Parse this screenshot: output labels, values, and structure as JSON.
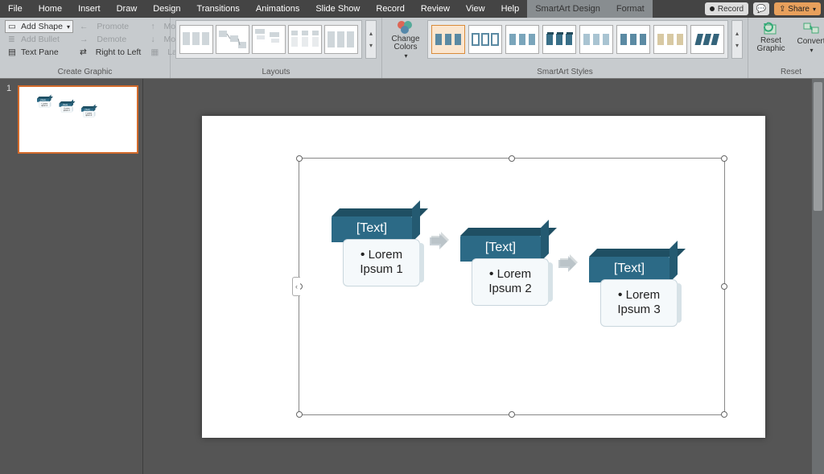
{
  "menu": {
    "tabs": [
      "File",
      "Home",
      "Insert",
      "Draw",
      "Design",
      "Transitions",
      "Animations",
      "Slide Show",
      "Record",
      "Review",
      "View",
      "Help",
      "SmartArt Design",
      "Format"
    ],
    "active": "SmartArt Design",
    "record": "Record",
    "share": "Share"
  },
  "ribbon": {
    "create": {
      "label": "Create Graphic",
      "add_shape": "Add Shape",
      "add_bullet": "Add Bullet",
      "text_pane": "Text Pane",
      "promote": "Promote",
      "demote": "Demote",
      "rtl": "Right to Left",
      "move_up": "Move Up",
      "move_down": "Move Down",
      "layout": "Layout"
    },
    "layouts": {
      "label": "Layouts"
    },
    "styles": {
      "label": "SmartArt Styles",
      "change_colors": "Change Colors"
    },
    "reset": {
      "label": "Reset",
      "reset_graphic": "Reset Graphic",
      "convert": "Convert"
    }
  },
  "thumbs": {
    "num": "1"
  },
  "smartart": {
    "blocks": [
      {
        "title": "[Text]",
        "body": "Lorem Ipsum 1"
      },
      {
        "title": "[Text]",
        "body": "Lorem Ipsum 2"
      },
      {
        "title": "[Text]",
        "body": "Lorem Ipsum 3"
      }
    ]
  },
  "colors": {
    "accent": "#2c6a86",
    "accent_dark": "#1f4f63",
    "selection": "#d26a2b"
  }
}
